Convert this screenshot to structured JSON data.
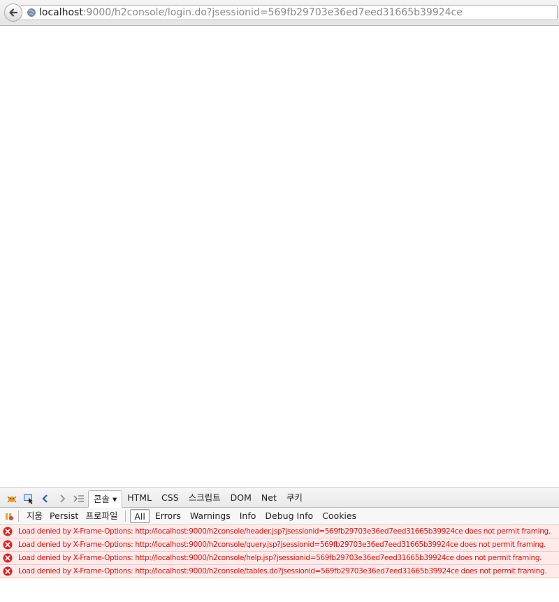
{
  "urlbar": {
    "host": "localhost",
    "rest": ":9000/h2console/login.do?jsessionid=569fb29703e36ed7eed31665b39924ce"
  },
  "firebug": {
    "tabs": [
      {
        "label": "콘솔 ▾",
        "name": "tab-console",
        "active": true
      },
      {
        "label": "HTML",
        "name": "tab-html"
      },
      {
        "label": "CSS",
        "name": "tab-css"
      },
      {
        "label": "스크립트",
        "name": "tab-script"
      },
      {
        "label": "DOM",
        "name": "tab-dom"
      },
      {
        "label": "Net",
        "name": "tab-net"
      },
      {
        "label": "쿠키",
        "name": "tab-cookies"
      }
    ],
    "toolbar": {
      "clear": "지움",
      "persist": "Persist",
      "profile": "프로파일",
      "filters": [
        {
          "label": "All",
          "active": true
        },
        {
          "label": "Errors"
        },
        {
          "label": "Warnings"
        },
        {
          "label": "Info"
        },
        {
          "label": "Debug Info"
        },
        {
          "label": "Cookies"
        }
      ]
    },
    "log": [
      "Load denied by X-Frame-Options: http://localhost:9000/h2console/header.jsp?jsessionid=569fb29703e36ed7eed31665b39924ce does not permit framing.",
      "Load denied by X-Frame-Options: http://localhost:9000/h2console/query.jsp?jsessionid=569fb29703e36ed7eed31665b39924ce does not permit framing.",
      "Load denied by X-Frame-Options: http://localhost:9000/h2console/help.jsp?jsessionid=569fb29703e36ed7eed31665b39924ce does not permit framing.",
      "Load denied by X-Frame-Options: http://localhost:9000/h2console/tables.do?jsessionid=569fb29703e36ed7eed31665b39924ce does not permit framing."
    ]
  },
  "colors": {
    "error_text": "#e01010",
    "error_bg": "#ffeaea",
    "accent_blue": "#2060c0"
  }
}
